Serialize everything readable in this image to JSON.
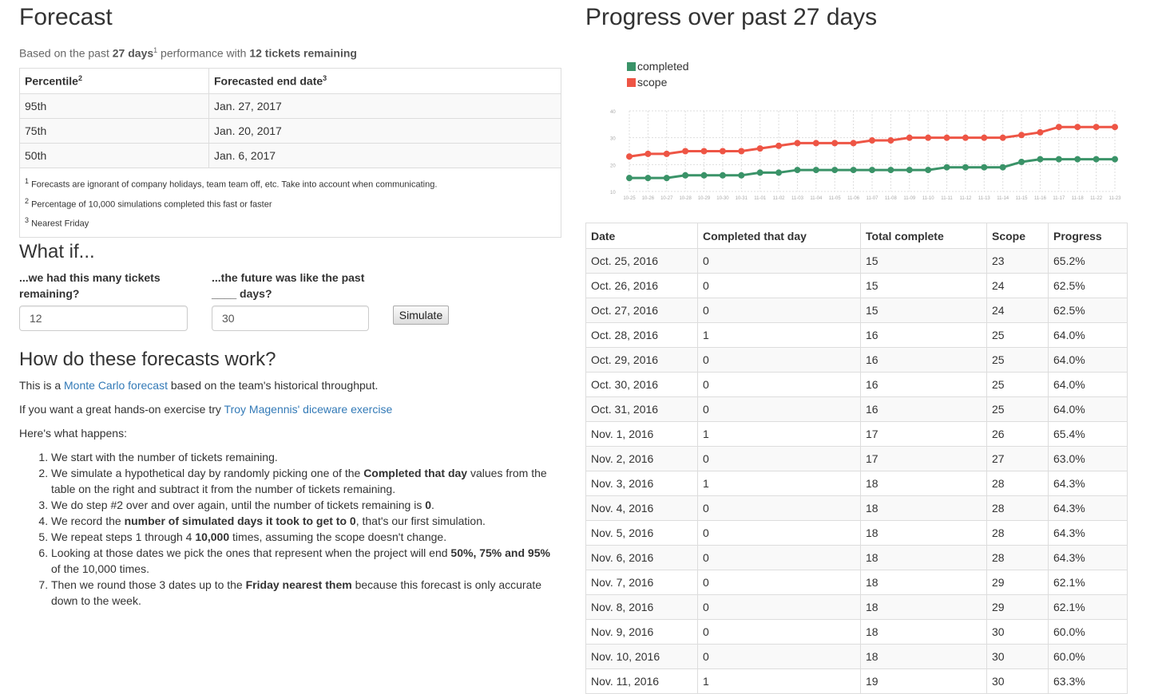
{
  "forecast": {
    "title": "Forecast",
    "intro": {
      "pre": "Based on the past ",
      "days": "27 days",
      "sup": "1",
      "mid": " performance with ",
      "tickets": "12 tickets remaining"
    },
    "headers": [
      {
        "label": "Percentile",
        "sup": "2"
      },
      {
        "label": "Forecasted end date",
        "sup": "3"
      }
    ],
    "rows": [
      {
        "percentile": "95th",
        "date": "Jan. 27, 2017"
      },
      {
        "percentile": "75th",
        "date": "Jan. 20, 2017"
      },
      {
        "percentile": "50th",
        "date": "Jan. 6, 2017"
      }
    ],
    "notes": [
      {
        "sup": "1",
        "text": " Forecasts are ignorant of company holidays, team team off, etc. Take into account when communicating."
      },
      {
        "sup": "2",
        "text": " Percentage of 10,000 simulations completed this fast or faster"
      },
      {
        "sup": "3",
        "text": " Nearest Friday"
      }
    ]
  },
  "whatif": {
    "title": "What if...",
    "tickets_label_1": "...we had this many tickets",
    "tickets_label_2": "remaining?",
    "days_label_1": "...the future was like the past",
    "days_label_2": "____ days?",
    "tickets_value": "12",
    "days_value": "30",
    "simulate_label": "Simulate"
  },
  "how": {
    "title": "How do these forecasts work?",
    "p1_pre": "This is a ",
    "p1_link": "Monte Carlo forecast",
    "p1_post": " based on the team's historical throughput.",
    "p2_pre": "If you want a great hands-on exercise try ",
    "p2_link": "Troy Magennis' diceware exercise",
    "p3": "Here's what happens:",
    "steps": [
      [
        {
          "t": "We start with the number of tickets remaining."
        }
      ],
      [
        {
          "t": "We simulate a hypothetical day by randomly picking one of the "
        },
        {
          "t": "Completed that day",
          "b": true
        },
        {
          "t": " values from the table on the right and subtract it from the number of tickets remaining."
        }
      ],
      [
        {
          "t": "We do step #2 over and over again, until the number of tickets remaining is "
        },
        {
          "t": "0",
          "b": true
        },
        {
          "t": "."
        }
      ],
      [
        {
          "t": "We record the "
        },
        {
          "t": "number of simulated days it took to get to 0",
          "b": true
        },
        {
          "t": ", that's our first simulation."
        }
      ],
      [
        {
          "t": "We repeat steps 1 through 4 "
        },
        {
          "t": "10,000",
          "b": true
        },
        {
          "t": " times, assuming the scope doesn't change."
        }
      ],
      [
        {
          "t": "Looking at those dates we pick the ones that represent when the project will end "
        },
        {
          "t": "50%, 75% and 95%",
          "b": true
        },
        {
          "t": " of the 10,000 times."
        }
      ],
      [
        {
          "t": "Then we round those 3 dates up to the "
        },
        {
          "t": "Friday nearest them",
          "b": true
        },
        {
          "t": " because this forecast is only accurate down to the week."
        }
      ]
    ]
  },
  "progress": {
    "title": "Progress over past 27 days",
    "columns": [
      "Date",
      "Completed that day",
      "Total complete",
      "Scope",
      "Progress"
    ],
    "rows": [
      [
        "Oct. 25, 2016",
        "0",
        "15",
        "23",
        "65.2%"
      ],
      [
        "Oct. 26, 2016",
        "0",
        "15",
        "24",
        "62.5%"
      ],
      [
        "Oct. 27, 2016",
        "0",
        "15",
        "24",
        "62.5%"
      ],
      [
        "Oct. 28, 2016",
        "1",
        "16",
        "25",
        "64.0%"
      ],
      [
        "Oct. 29, 2016",
        "0",
        "16",
        "25",
        "64.0%"
      ],
      [
        "Oct. 30, 2016",
        "0",
        "16",
        "25",
        "64.0%"
      ],
      [
        "Oct. 31, 2016",
        "0",
        "16",
        "25",
        "64.0%"
      ],
      [
        "Nov. 1, 2016",
        "1",
        "17",
        "26",
        "65.4%"
      ],
      [
        "Nov. 2, 2016",
        "0",
        "17",
        "27",
        "63.0%"
      ],
      [
        "Nov. 3, 2016",
        "1",
        "18",
        "28",
        "64.3%"
      ],
      [
        "Nov. 4, 2016",
        "0",
        "18",
        "28",
        "64.3%"
      ],
      [
        "Nov. 5, 2016",
        "0",
        "18",
        "28",
        "64.3%"
      ],
      [
        "Nov. 6, 2016",
        "0",
        "18",
        "28",
        "64.3%"
      ],
      [
        "Nov. 7, 2016",
        "0",
        "18",
        "29",
        "62.1%"
      ],
      [
        "Nov. 8, 2016",
        "0",
        "18",
        "29",
        "62.1%"
      ],
      [
        "Nov. 9, 2016",
        "0",
        "18",
        "30",
        "60.0%"
      ],
      [
        "Nov. 10, 2016",
        "0",
        "18",
        "30",
        "60.0%"
      ],
      [
        "Nov. 11, 2016",
        "1",
        "19",
        "30",
        "63.3%"
      ]
    ]
  },
  "chart_data": {
    "type": "line",
    "title": "",
    "xlabel": "",
    "ylabel": "",
    "x": [
      "10-25",
      "10-26",
      "10-27",
      "10-28",
      "10-29",
      "10-30",
      "10-31",
      "11-01",
      "11-02",
      "11-03",
      "11-04",
      "11-05",
      "11-06",
      "11-07",
      "11-08",
      "11-09",
      "11-10",
      "11-11",
      "11-12",
      "11-13",
      "11-14",
      "11-15",
      "11-16",
      "11-17",
      "11-18",
      "11-22",
      "11-23"
    ],
    "ylim": [
      10,
      40
    ],
    "yticks": [
      10,
      20,
      30,
      40
    ],
    "grid": true,
    "legend": "top-left",
    "series": [
      {
        "name": "completed",
        "color": "#3a9368",
        "values": [
          15,
          15,
          15,
          16,
          16,
          16,
          16,
          17,
          17,
          18,
          18,
          18,
          18,
          18,
          18,
          18,
          18,
          19,
          19,
          19,
          19,
          21,
          22,
          22,
          22,
          22,
          22
        ]
      },
      {
        "name": "scope",
        "color": "#ee5545",
        "values": [
          23,
          24,
          24,
          25,
          25,
          25,
          25,
          26,
          27,
          28,
          28,
          28,
          28,
          29,
          29,
          30,
          30,
          30,
          30,
          30,
          30,
          31,
          32,
          34,
          34,
          34,
          34
        ]
      }
    ]
  }
}
